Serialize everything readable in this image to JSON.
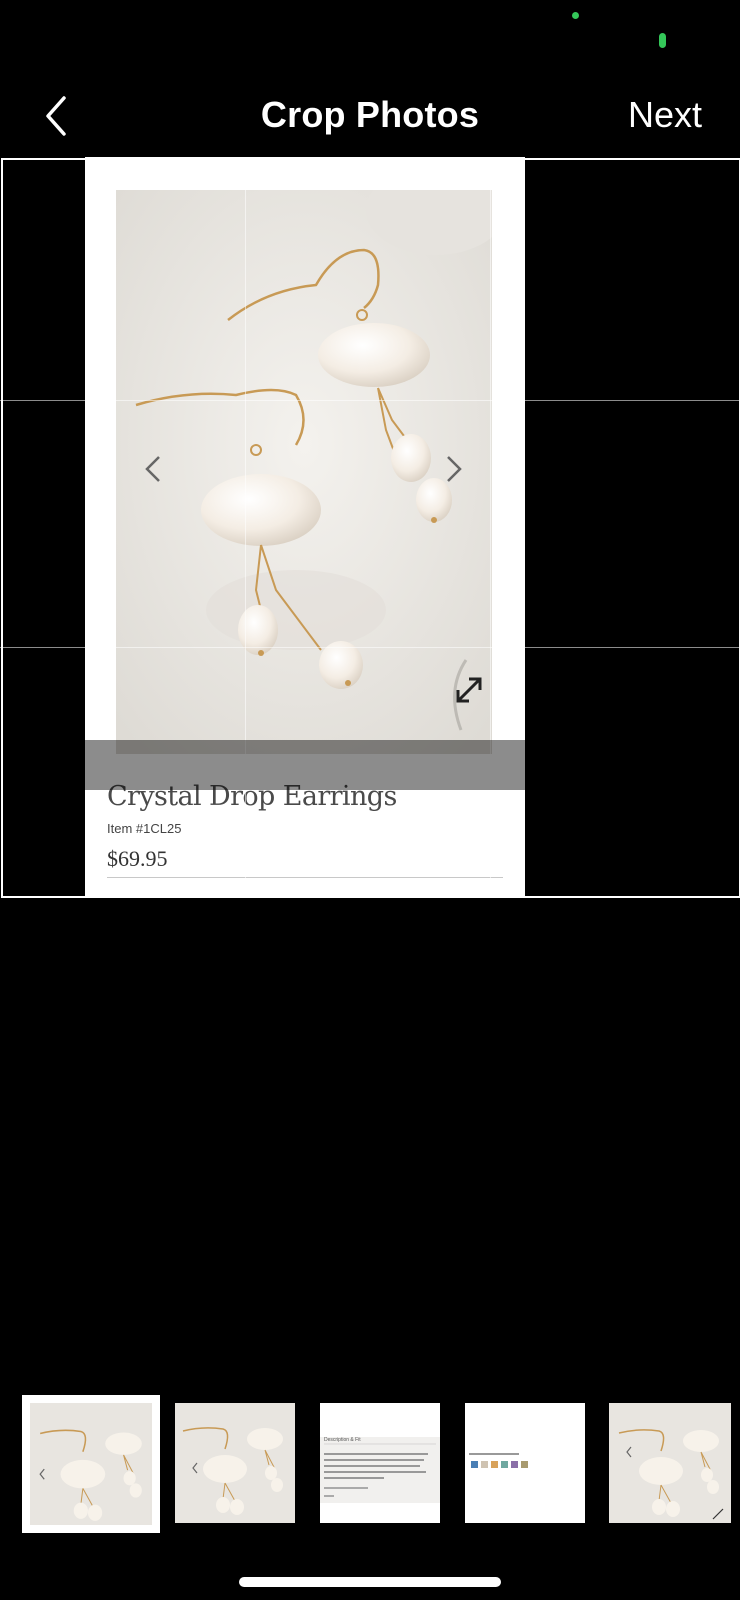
{
  "nav": {
    "title": "Crop Photos",
    "next_label": "Next",
    "back_icon": "chevron-left-icon"
  },
  "product": {
    "title": "Crystal Drop Earrings",
    "item_number": "Item #1CL25",
    "price": "$69.95",
    "choose_color": "Choose your color:"
  },
  "thumbnails": [
    {
      "kind": "earrings-photo",
      "selected": true
    },
    {
      "kind": "earrings-photo",
      "selected": false
    },
    {
      "kind": "description-page",
      "selected": false,
      "heading": "Description & Fit"
    },
    {
      "kind": "color-swatches",
      "selected": false
    },
    {
      "kind": "earrings-photo",
      "selected": false
    }
  ],
  "colors": {
    "status_green": "#34c759",
    "gold": "#c89a55",
    "pearl": "#f5efe6"
  }
}
